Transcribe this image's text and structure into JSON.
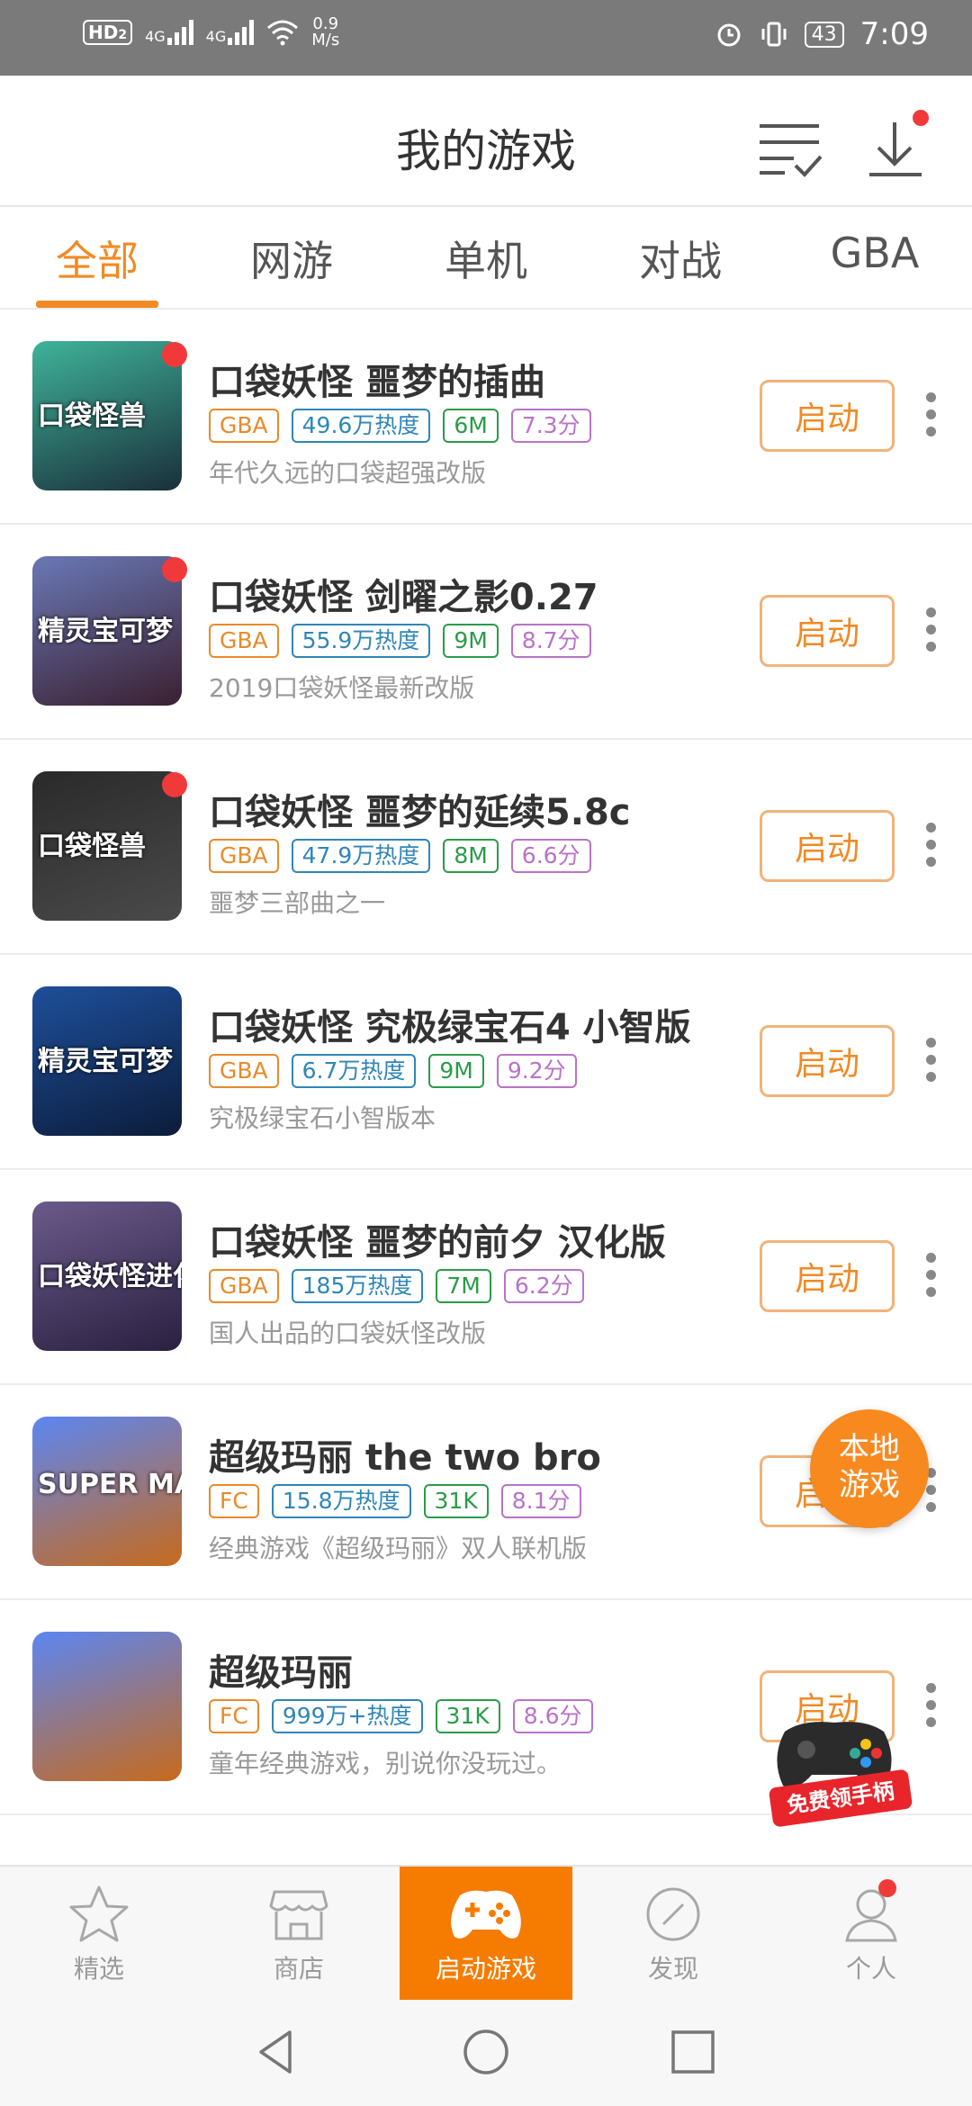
{
  "status_bar": {
    "hd": "HD",
    "hd_sub": "2",
    "net1": "4G",
    "net2": "4G",
    "speed_value": "0.9",
    "speed_unit": "M/s",
    "battery": "43",
    "time": "7:09"
  },
  "header": {
    "title": "我的游戏",
    "list_icon": "checklist-icon",
    "download_icon": "download-icon"
  },
  "tabs": [
    {
      "label": "全部",
      "active": true
    },
    {
      "label": "网游",
      "active": false
    },
    {
      "label": "单机",
      "active": false
    },
    {
      "label": "对战",
      "active": false
    },
    {
      "label": "GBA",
      "active": false
    }
  ],
  "games": [
    {
      "name": "口袋妖怪 噩梦的插曲",
      "platform": "GBA",
      "heat": "49.6万热度",
      "size": "6M",
      "score": "7.3分",
      "desc": "年代久远的口袋超强改版",
      "thumb_text": "口袋怪兽",
      "new": true,
      "colors": [
        "#3fb39a",
        "#1a2f3a"
      ]
    },
    {
      "name": "口袋妖怪 剑曜之影0.27",
      "platform": "GBA",
      "heat": "55.9万热度",
      "size": "9M",
      "score": "8.7分",
      "desc": "2019口袋妖怪最新改版",
      "thumb_text": "精灵宝可梦",
      "new": true,
      "colors": [
        "#6a78b5",
        "#3a2030"
      ]
    },
    {
      "name": "口袋妖怪 噩梦的延续5.8c",
      "platform": "GBA",
      "heat": "47.9万热度",
      "size": "8M",
      "score": "6.6分",
      "desc": "噩梦三部曲之一",
      "thumb_text": "口袋怪兽",
      "new": true,
      "colors": [
        "#2a2a2a",
        "#4a4a4a"
      ]
    },
    {
      "name": "口袋妖怪 究极绿宝石4 小智版",
      "platform": "GBA",
      "heat": "6.7万热度",
      "size": "9M",
      "score": "9.2分",
      "desc": "究极绿宝石小智版本",
      "thumb_text": "精灵宝可梦",
      "new": false,
      "colors": [
        "#1e4f9a",
        "#0c1c3a"
      ]
    },
    {
      "name": "口袋妖怪 噩梦的前夕 汉化版",
      "platform": "GBA",
      "heat": "185万热度",
      "size": "7M",
      "score": "6.2分",
      "desc": "国人出品的口袋妖怪改版",
      "thumb_text": "口袋妖怪进化论",
      "new": false,
      "colors": [
        "#6a5a8a",
        "#2a2040"
      ]
    },
    {
      "name": "超级玛丽 the two bro",
      "platform": "FC",
      "heat": "15.8万热度",
      "size": "31K",
      "score": "8.1分",
      "desc": "经典游戏《超级玛丽》双人联机版",
      "thumb_text": "SUPER MARIO BROS.",
      "new": false,
      "colors": [
        "#5c86f2",
        "#c76a1c"
      ]
    },
    {
      "name": "超级玛丽",
      "platform": "FC",
      "heat": "999万+热度",
      "size": "31K",
      "score": "8.6分",
      "desc": "童年经典游戏，别说你没玩过。",
      "thumb_text": "",
      "new": false,
      "colors": [
        "#5c86f2",
        "#c76a1c"
      ]
    },
    {
      "name": "",
      "platform": "",
      "heat": "",
      "size": "",
      "score": "",
      "desc": "",
      "thumb_text": "",
      "new": false,
      "colors": [
        "#4fb3e8",
        "#9ad4f2"
      ]
    }
  ],
  "launch_label": "启动",
  "fab_local": {
    "line1": "本地",
    "line2": "游戏"
  },
  "fab_gamepad": {
    "label": "免费领手柄"
  },
  "bottom_nav": [
    {
      "label": "精选",
      "icon": "star-icon",
      "active": false
    },
    {
      "label": "商店",
      "icon": "store-icon",
      "active": false
    },
    {
      "label": "启动游戏",
      "icon": "gamepad-icon",
      "active": true
    },
    {
      "label": "发现",
      "icon": "compass-icon",
      "active": false
    },
    {
      "label": "个人",
      "icon": "person-icon",
      "active": false,
      "badge": true
    }
  ],
  "system_nav": [
    "back-icon",
    "home-icon",
    "recents-icon"
  ],
  "colors": {
    "accent": "#f08a24",
    "nav_active": "#f57c00",
    "badge": "#f03a3a"
  }
}
